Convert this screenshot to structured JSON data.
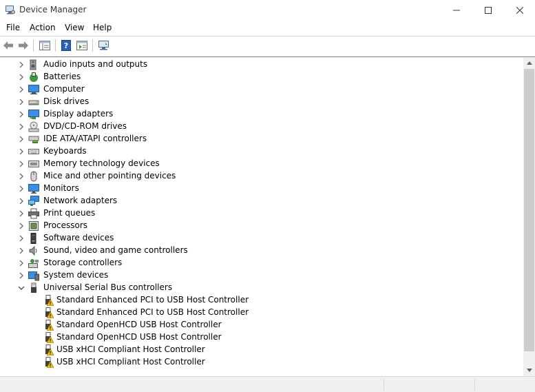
{
  "window": {
    "title": "Device Manager"
  },
  "menu": {
    "items": [
      {
        "label": "File"
      },
      {
        "label": "Action"
      },
      {
        "label": "View"
      },
      {
        "label": "Help"
      }
    ]
  },
  "toolbar": {
    "buttons": [
      "back-arrow-icon",
      "forward-arrow-icon",
      "properties-icon",
      "help-icon",
      "action-pane-icon",
      "monitor-icon"
    ]
  },
  "tree": {
    "categories": [
      {
        "label": "Audio inputs and outputs",
        "icon": "speaker-icon",
        "expanded": false
      },
      {
        "label": "Batteries",
        "icon": "battery-icon",
        "expanded": false
      },
      {
        "label": "Computer",
        "icon": "computer-icon",
        "expanded": false
      },
      {
        "label": "Disk drives",
        "icon": "disk-drive-icon",
        "expanded": false
      },
      {
        "label": "Display adapters",
        "icon": "display-adapter-icon",
        "expanded": false
      },
      {
        "label": "DVD/CD-ROM drives",
        "icon": "dvd-drive-icon",
        "expanded": false
      },
      {
        "label": "IDE ATA/ATAPI controllers",
        "icon": "ide-controller-icon",
        "expanded": false
      },
      {
        "label": "Keyboards",
        "icon": "keyboard-icon",
        "expanded": false
      },
      {
        "label": "Memory technology devices",
        "icon": "memory-icon",
        "expanded": false
      },
      {
        "label": "Mice and other pointing devices",
        "icon": "mouse-icon",
        "expanded": false
      },
      {
        "label": "Monitors",
        "icon": "monitor-icon",
        "expanded": false
      },
      {
        "label": "Network adapters",
        "icon": "network-adapter-icon",
        "expanded": false
      },
      {
        "label": "Print queues",
        "icon": "printer-icon",
        "expanded": false
      },
      {
        "label": "Processors",
        "icon": "processor-icon",
        "expanded": false
      },
      {
        "label": "Software devices",
        "icon": "software-device-icon",
        "expanded": false
      },
      {
        "label": "Sound, video and game controllers",
        "icon": "sound-icon",
        "expanded": false
      },
      {
        "label": "Storage controllers",
        "icon": "storage-controller-icon",
        "expanded": false
      },
      {
        "label": "System devices",
        "icon": "system-device-icon",
        "expanded": false
      },
      {
        "label": "Universal Serial Bus controllers",
        "icon": "usb-icon",
        "expanded": true
      }
    ],
    "usb_children": [
      {
        "label": "Standard Enhanced PCI to USB Host Controller",
        "icon": "usb-warning-icon"
      },
      {
        "label": "Standard Enhanced PCI to USB Host Controller",
        "icon": "usb-warning-icon"
      },
      {
        "label": "Standard OpenHCD USB Host Controller",
        "icon": "usb-warning-icon"
      },
      {
        "label": "Standard OpenHCD USB Host Controller",
        "icon": "usb-warning-icon"
      },
      {
        "label": "USB xHCI Compliant Host Controller",
        "icon": "usb-warning-icon"
      },
      {
        "label": "USB xHCI Compliant Host Controller",
        "icon": "usb-warning-icon"
      }
    ]
  },
  "colors": {
    "warning": "#f5c400",
    "accent_blue": "#1e6fd9"
  }
}
